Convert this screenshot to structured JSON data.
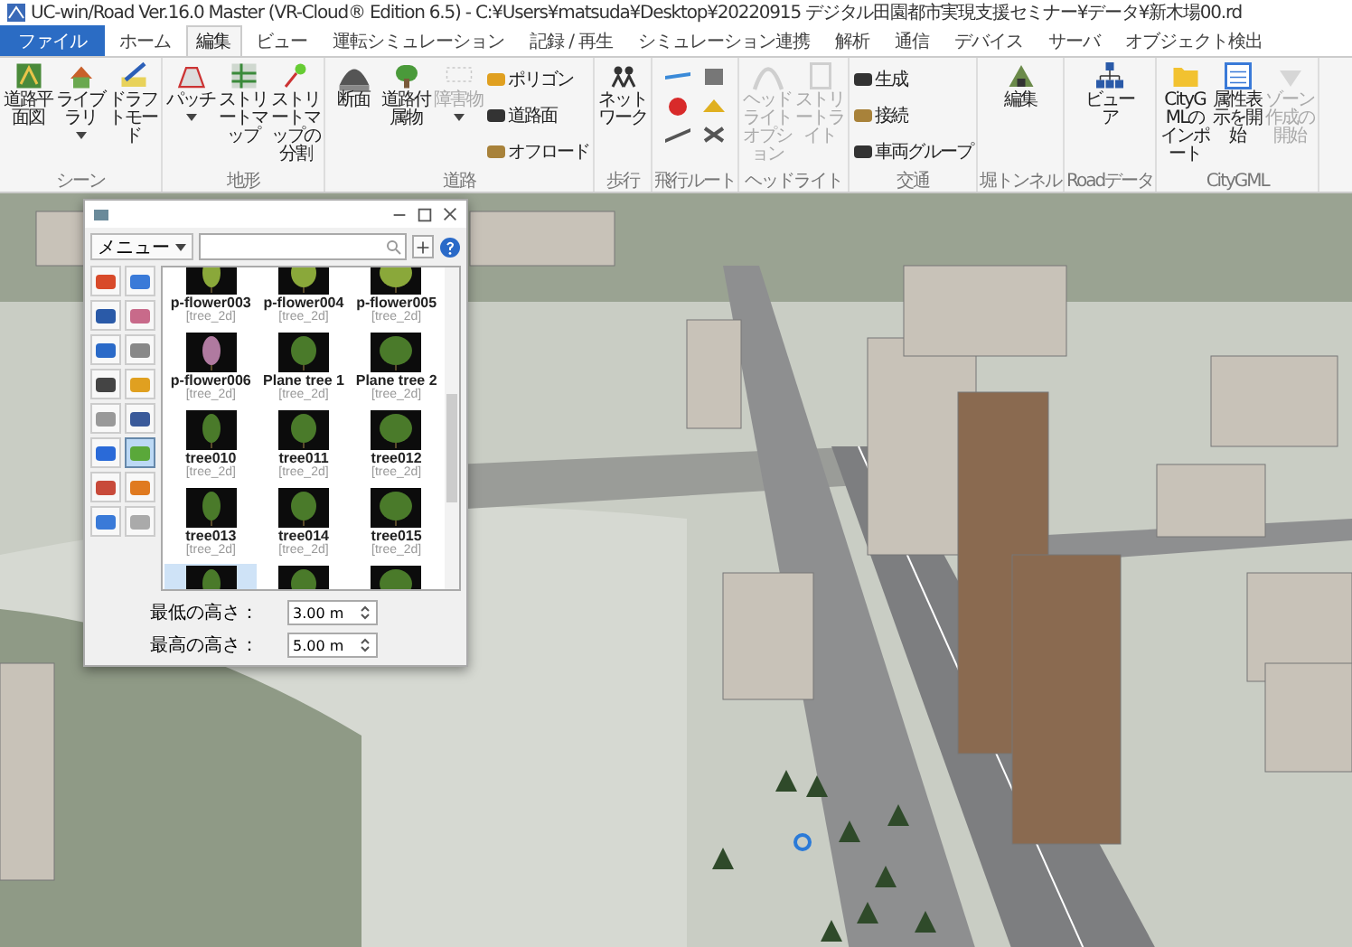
{
  "window": {
    "title": "UC-win/Road Ver.16.0 Master (VR-Cloud® Edition 6.5) - C:¥Users¥matsuda¥Desktop¥20220915 デジタル田園都市実現支援セミナー¥データ¥新木場00.rd"
  },
  "menu_tabs": [
    {
      "label": "ファイル",
      "selected": false,
      "kind": "file"
    },
    {
      "label": "ホーム",
      "selected": false,
      "kind": "tab"
    },
    {
      "label": "編集",
      "selected": true,
      "kind": "tab"
    },
    {
      "label": "ビュー",
      "selected": false,
      "kind": "tab"
    },
    {
      "label": "運転シミュレーション",
      "selected": false,
      "kind": "tab"
    },
    {
      "label": "記録 / 再生",
      "selected": false,
      "kind": "tab"
    },
    {
      "label": "シミュレーション連携",
      "selected": false,
      "kind": "tab"
    },
    {
      "label": "解析",
      "selected": false,
      "kind": "tab"
    },
    {
      "label": "通信",
      "selected": false,
      "kind": "tab"
    },
    {
      "label": "デバイス",
      "selected": false,
      "kind": "tab"
    },
    {
      "label": "サーバ",
      "selected": false,
      "kind": "tab"
    },
    {
      "label": "オブジェクト検出",
      "selected": false,
      "kind": "tab"
    }
  ],
  "ribbon": [
    {
      "label": "シーン",
      "items": [
        {
          "kind": "large",
          "label": "道路平面図",
          "dropdown": false,
          "disabled": false
        },
        {
          "kind": "large",
          "label": "ライブラリ",
          "dropdown": true,
          "disabled": false
        },
        {
          "kind": "large",
          "label": "ドラフトモード",
          "dropdown": false,
          "disabled": false
        }
      ]
    },
    {
      "label": "地形",
      "items": [
        {
          "kind": "large",
          "label": "パッチ",
          "dropdown": true,
          "disabled": false
        },
        {
          "kind": "large",
          "label": "ストリートマップ",
          "dropdown": false,
          "disabled": false
        },
        {
          "kind": "large",
          "label": "ストリートマップの分割",
          "dropdown": false,
          "disabled": false
        }
      ]
    },
    {
      "label": "道路",
      "items": [
        {
          "kind": "large",
          "label": "断面",
          "dropdown": false,
          "disabled": false
        },
        {
          "kind": "large",
          "label": "道路付属物",
          "dropdown": false,
          "disabled": false
        },
        {
          "kind": "large",
          "label": "障害物",
          "dropdown": true,
          "disabled": true
        },
        {
          "kind": "stack",
          "rows": [
            "ポリゴン",
            "道路面",
            "オフロード"
          ]
        }
      ]
    },
    {
      "label": "歩行",
      "items": [
        {
          "kind": "large",
          "label": "ネットワーク",
          "dropdown": false,
          "disabled": false
        }
      ]
    },
    {
      "label": "飛行ルート",
      "items": [
        {
          "kind": "icon_grid"
        }
      ]
    },
    {
      "label": "ヘッドライト",
      "items": [
        {
          "kind": "large",
          "label": "ヘッドライトオプション",
          "dropdown": false,
          "disabled": true
        },
        {
          "kind": "large",
          "label": "ストリートライト",
          "dropdown": false,
          "disabled": true
        }
      ]
    },
    {
      "label": "交通",
      "items": [
        {
          "kind": "stack",
          "rows": [
            "生成",
            "接続",
            "車両グループ"
          ]
        }
      ]
    },
    {
      "label": "堀トンネル",
      "items": [
        {
          "kind": "large",
          "label": "編集",
          "dropdown": false,
          "disabled": false
        }
      ]
    },
    {
      "label": "Roadデータ",
      "items": [
        {
          "kind": "large",
          "label": "ビューア",
          "dropdown": false,
          "disabled": false
        }
      ]
    },
    {
      "label": "CityGML",
      "items": [
        {
          "kind": "large",
          "label": "CityGMLのインポート",
          "dropdown": false,
          "disabled": false
        },
        {
          "kind": "large",
          "label": "属性表示を開始",
          "dropdown": false,
          "disabled": false
        },
        {
          "kind": "large",
          "label": "ゾーン作成の開始",
          "dropdown": false,
          "disabled": true
        }
      ]
    }
  ],
  "dialog": {
    "menu_button": "メニュー",
    "palette": [
      {
        "selected": false
      },
      {
        "selected": false
      },
      {
        "selected": false
      },
      {
        "selected": false
      },
      {
        "selected": false
      },
      {
        "selected": false
      },
      {
        "selected": false
      },
      {
        "selected": false
      },
      {
        "selected": false
      },
      {
        "selected": false
      },
      {
        "selected": false
      },
      {
        "selected": true
      },
      {
        "selected": false
      },
      {
        "selected": false
      },
      {
        "selected": false
      },
      {
        "selected": false
      }
    ],
    "tiles": [
      {
        "name": "p-flower003",
        "type": "[tree_2d]",
        "selected": false
      },
      {
        "name": "p-flower004",
        "type": "[tree_2d]",
        "selected": false
      },
      {
        "name": "p-flower005",
        "type": "[tree_2d]",
        "selected": false
      },
      {
        "name": "p-flower006",
        "type": "[tree_2d]",
        "selected": false
      },
      {
        "name": "Plane tree 1",
        "type": "[tree_2d]",
        "selected": false
      },
      {
        "name": "Plane tree 2",
        "type": "[tree_2d]",
        "selected": false
      },
      {
        "name": "tree010",
        "type": "[tree_2d]",
        "selected": false
      },
      {
        "name": "tree011",
        "type": "[tree_2d]",
        "selected": false
      },
      {
        "name": "tree012",
        "type": "[tree_2d]",
        "selected": false
      },
      {
        "name": "tree013",
        "type": "[tree_2d]",
        "selected": false
      },
      {
        "name": "tree014",
        "type": "[tree_2d]",
        "selected": false
      },
      {
        "name": "tree015",
        "type": "[tree_2d]",
        "selected": false
      },
      {
        "selected": true
      },
      {
        "selected": false
      },
      {
        "selected": false
      }
    ],
    "fields": [
      {
        "label": "最低の高さ：",
        "value": "3.00 m"
      },
      {
        "label": "最高の高さ：",
        "value": "5.00 m"
      }
    ]
  }
}
